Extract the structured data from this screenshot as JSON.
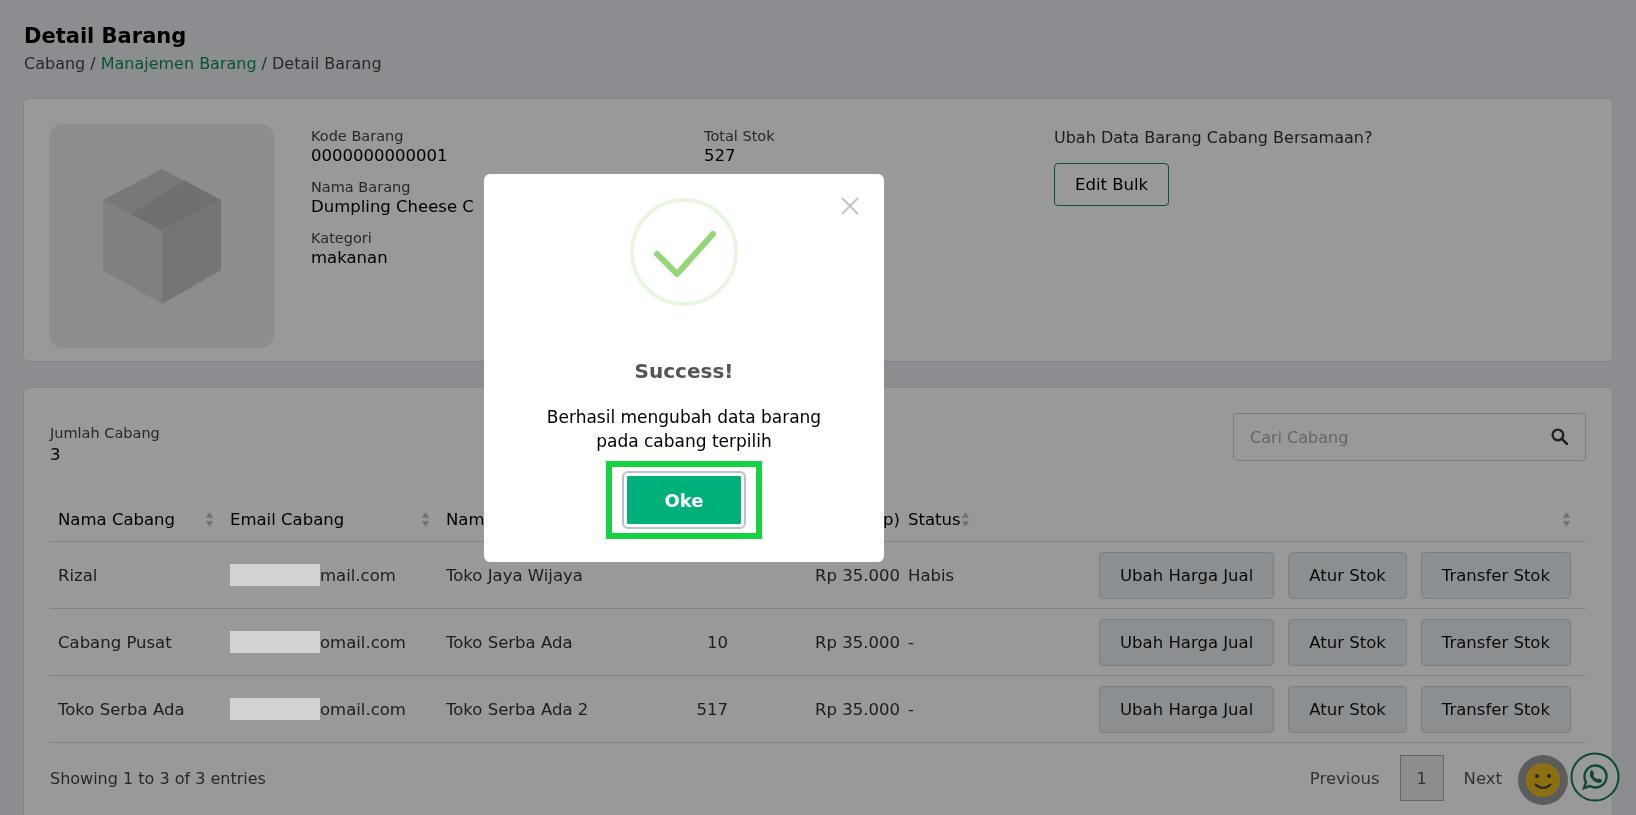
{
  "page": {
    "title": "Detail Barang",
    "breadcrumb": [
      {
        "label": "Cabang",
        "kind": "text"
      },
      {
        "label": "/",
        "kind": "separator"
      },
      {
        "label": "Manajemen Barang",
        "kind": "link"
      },
      {
        "label": "/",
        "kind": "separator"
      },
      {
        "label": "Detail Barang",
        "kind": "text"
      }
    ]
  },
  "product": {
    "fields": [
      {
        "label": "Kode Barang",
        "value": "0000000000001"
      },
      {
        "label": "Nama Barang",
        "value": "Dumpling Cheese C"
      },
      {
        "label": "Kategori",
        "value": "makanan"
      }
    ],
    "total_stock": {
      "label": "Total Stok",
      "value": "527"
    },
    "bulk": {
      "prompt": "Ubah Data Barang Cabang Bersamaan?",
      "button": "Edit Bulk"
    }
  },
  "branches": {
    "count_label": "Jumlah Cabang",
    "count": "3",
    "search": {
      "placeholder": "Cari Cabang"
    },
    "table": {
      "columns": [
        {
          "label": "Nama Cabang",
          "sortable": true
        },
        {
          "label": "Email Cabang",
          "sortable": true
        },
        {
          "label": "Nam"
        },
        {},
        {
          "label": "p)"
        },
        {
          "label": "Status",
          "sortable": true
        },
        {
          "sortable": true
        }
      ],
      "rows": [
        {
          "name": "Rizal",
          "email": "mail.com",
          "redacted": true,
          "store": "Toko Jaya Wijaya",
          "price": "Rp 35.000",
          "status": "Habis",
          "actions": [
            "Ubah Harga Jual",
            "Atur Stok",
            "Transfer Stok"
          ]
        },
        {
          "name": "Cabang Pusat",
          "email": "omail.com",
          "redacted": true,
          "store": "Toko Serba Ada",
          "qty": "10",
          "price": "Rp 35.000",
          "status": "-",
          "actions": [
            "Ubah Harga Jual",
            "Atur Stok",
            "Transfer Stok"
          ]
        },
        {
          "name": "Toko Serba Ada",
          "email": "omail.com",
          "redacted": true,
          "store": "Toko Serba Ada 2",
          "qty": "517",
          "price": "Rp 35.000",
          "status": "-",
          "actions": [
            "Ubah Harga Jual",
            "Atur Stok",
            "Transfer Stok"
          ]
        }
      ]
    },
    "footer": "Showing 1 to 3 of 3 entries",
    "pagination": {
      "previous": "Previous",
      "pages": [
        {
          "label": "1",
          "selected": true
        }
      ],
      "next": "Next"
    }
  },
  "modal": {
    "title": "Success!",
    "message": "Berhasil mengubah data barang pada cabang terpilih",
    "button": "Oke",
    "highlighted": true
  }
}
